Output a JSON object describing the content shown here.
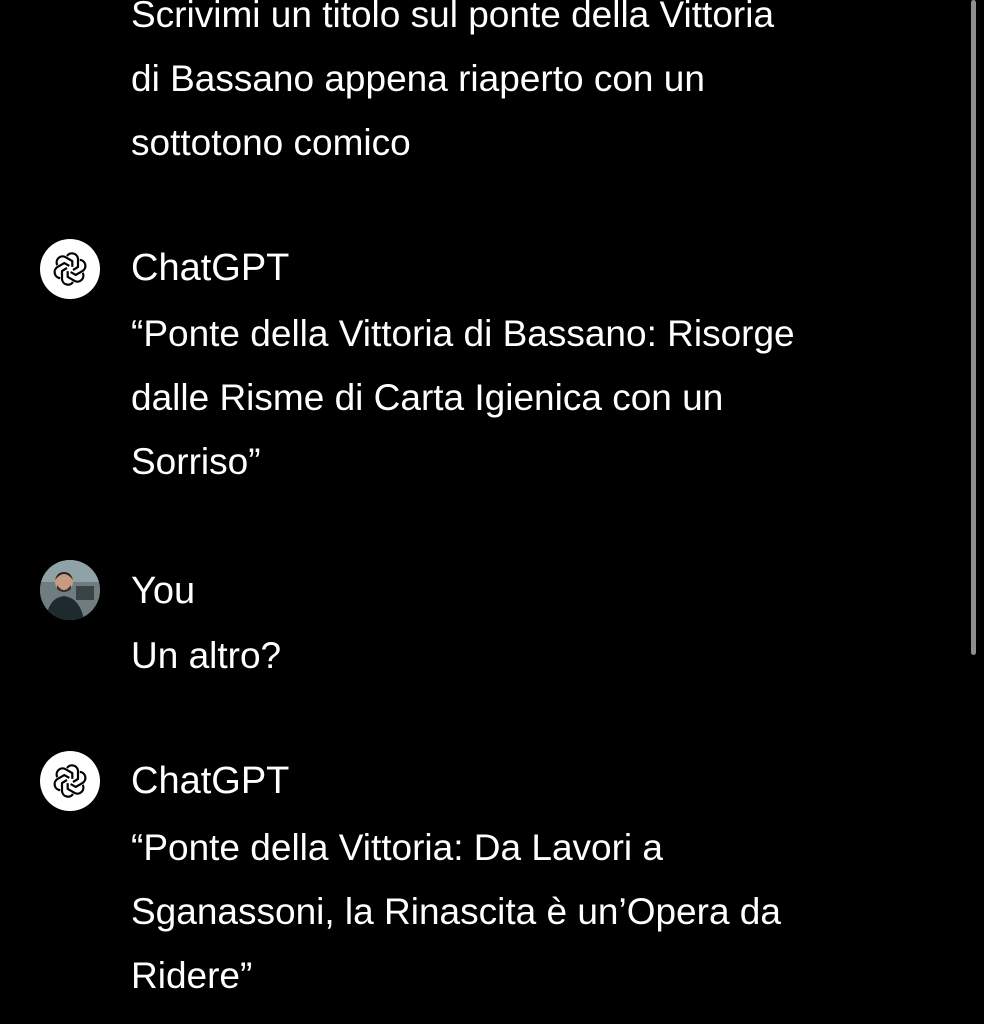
{
  "conversation": {
    "messages": [
      {
        "sender": "",
        "lines": [
          "Scrivimi un titolo sul ponte della Vittoria",
          "di Bassano appena riaperto con un",
          "sottotono comico"
        ]
      },
      {
        "sender": "ChatGPT",
        "avatar_icon": "openai-logo-icon",
        "lines": [
          "“Ponte della Vittoria di Bassano: Risorge",
          "dalle Risme di Carta Igienica con un",
          "Sorriso”"
        ]
      },
      {
        "sender": "You",
        "avatar_icon": "user-photo",
        "lines": [
          "Un altro?"
        ]
      },
      {
        "sender": "ChatGPT",
        "avatar_icon": "openai-logo-icon",
        "lines": [
          "“Ponte della Vittoria: Da Lavori a",
          "Sganassoni, la Rinascita è un’Opera da",
          "Ridere”"
        ]
      }
    ]
  },
  "theme": {
    "background": "#000000",
    "text": "#ffffff",
    "scrollbar": "#8e8e8e"
  }
}
